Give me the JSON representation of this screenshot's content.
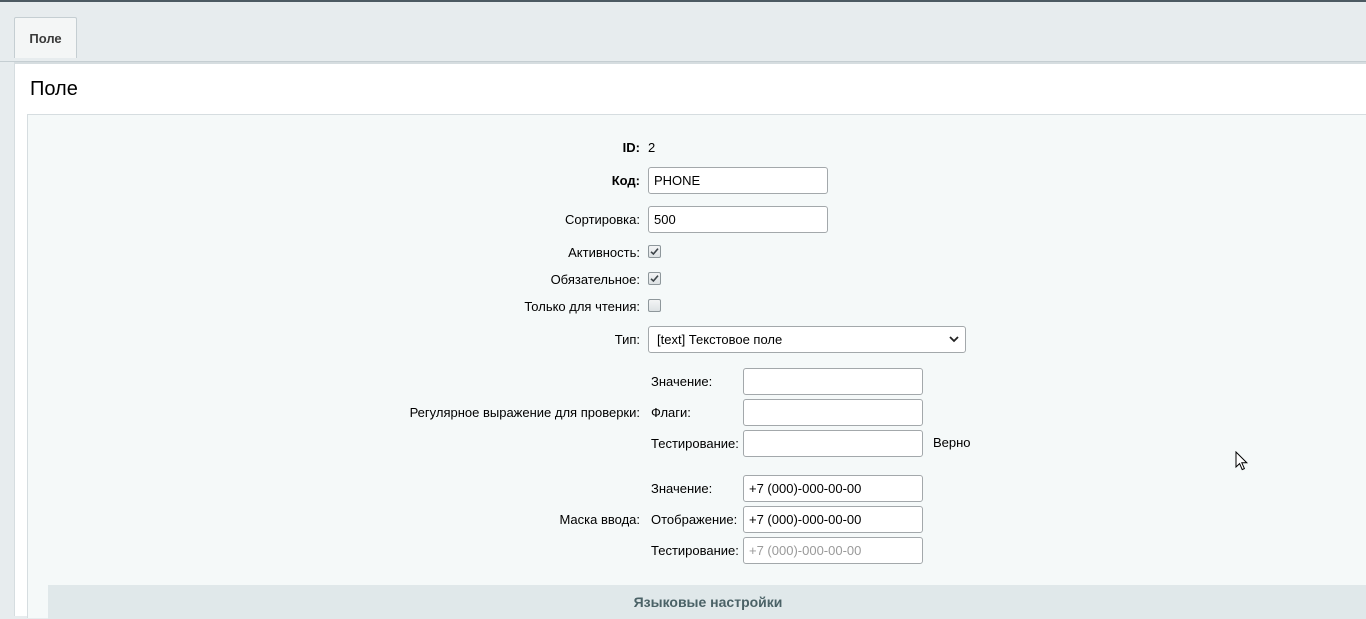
{
  "tabs": [
    {
      "label": "Поле",
      "active": true
    }
  ],
  "page": {
    "title": "Поле"
  },
  "form": {
    "id_label": "ID:",
    "id_value": "2",
    "code_label": "Код:",
    "code_value": "PHONE",
    "sort_label": "Сортировка:",
    "sort_value": "500",
    "active_label": "Активность:",
    "active_checked": true,
    "required_label": "Обязательное:",
    "required_checked": true,
    "readonly_label": "Только для чтения:",
    "readonly_checked": false,
    "type_label": "Тип:",
    "type_value": "[text] Текстовое поле",
    "regex": {
      "label": "Регулярное выражение для проверки:",
      "value_label": "Значение:",
      "value": "",
      "flags_label": "Флаги:",
      "flags": "",
      "test_label": "Тестирование:",
      "test": "",
      "result": "Верно"
    },
    "mask": {
      "label": "Маска ввода:",
      "value_label": "Значение:",
      "value": "+7 (000)-000-00-00",
      "display_label": "Отображение:",
      "display": "+7 (000)-000-00-00",
      "test_label": "Тестирование:",
      "test": "",
      "test_placeholder": "+7 (000)-000-00-00"
    }
  },
  "lang_section": {
    "title": "Языковые настройки"
  },
  "icons": {
    "checkbox": "check-icon",
    "dropdown": "chevron-down-icon",
    "pointer": "mouse-pointer-icon"
  }
}
